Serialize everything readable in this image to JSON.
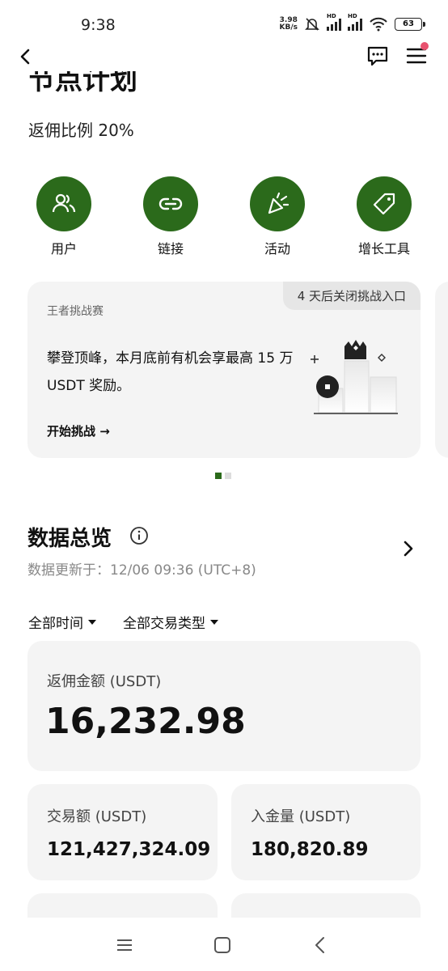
{
  "status_bar": {
    "time": "9:38",
    "net_speed_value": "3.98",
    "net_speed_unit": "KB/s",
    "signal_tag": "HD",
    "battery": "63"
  },
  "header": {
    "title": "节点计划",
    "rebate_ratio": "返佣比例 20%"
  },
  "actions": [
    {
      "label": "用户",
      "icon": "users-icon"
    },
    {
      "label": "链接",
      "icon": "link-icon"
    },
    {
      "label": "活动",
      "icon": "party-popper-icon"
    },
    {
      "label": "增长工具",
      "icon": "tag-icon"
    }
  ],
  "challenge_card": {
    "countdown": "4 天后关闭挑战入口",
    "tag": "王者挑战赛",
    "description": "攀登顶峰，本月底前有机会享最高 15 万 USDT 奖励。",
    "cta": "开始挑战 →"
  },
  "overview": {
    "title": "数据总览",
    "updated_at": "数据更新于：12/06 09:36 (UTC+8)",
    "filter_time": "全部时间",
    "filter_type": "全部交易类型"
  },
  "stats": {
    "rebate_label": "返佣金额 (USDT)",
    "rebate_value": "16,232.98",
    "volume_label": "交易额 (USDT)",
    "volume_value": "121,427,324.09",
    "deposit_label": "入金量 (USDT)",
    "deposit_value": "180,820.89"
  },
  "colors": {
    "brand_green": "#2b6a1b",
    "card_bg": "#f4f4f4",
    "notification_dot": "#e8526f"
  }
}
